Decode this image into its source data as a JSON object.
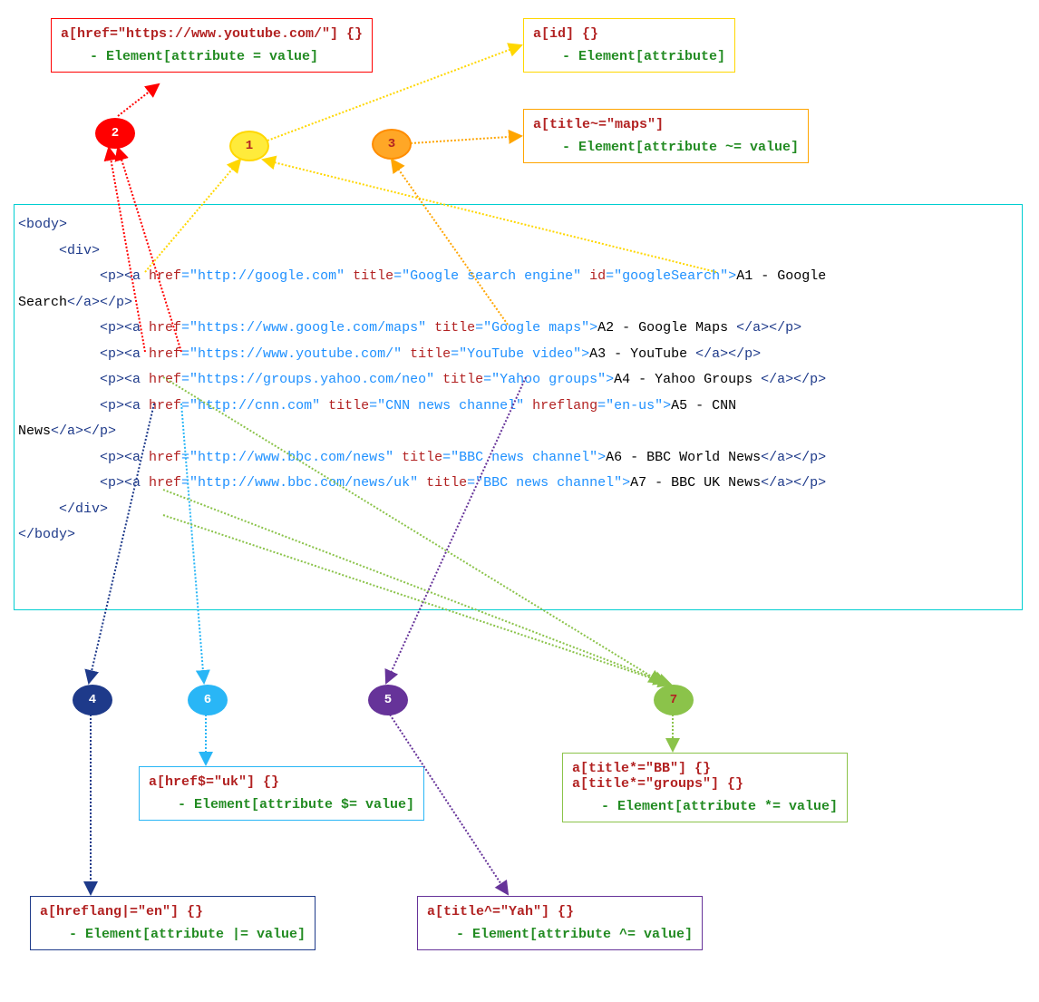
{
  "boxes": {
    "b1": {
      "rule": "a[id] {}",
      "pattern": "- Element[attribute]"
    },
    "b2": {
      "rule": "a[href=\"https://www.youtube.com/\"] {}",
      "pattern": "- Element[attribute = value]"
    },
    "b3": {
      "rule": "a[title~=\"maps\"]",
      "pattern": "- Element[attribute ~= value]"
    },
    "b4": {
      "rule": "a[hreflang|=\"en\"] {}",
      "pattern": "- Element[attribute |= value]"
    },
    "b5": {
      "rule": "a[title^=\"Yah\"] {}",
      "pattern": "- Element[attribute ^= value]"
    },
    "b6": {
      "rule": "a[href$=\"uk\"] {}",
      "pattern": "- Element[attribute $= value]"
    },
    "b7": {
      "rule1": "a[title*=\"BB\"] {}",
      "rule2": "a[title*=\"groups\"] {}",
      "pattern": "- Element[attribute *= value]"
    }
  },
  "ellipses": {
    "e1": "1",
    "e2": "2",
    "e3": "3",
    "e4": "4",
    "e5": "5",
    "e6": "6",
    "e7": "7"
  },
  "code": {
    "body_open": "<body>",
    "div_open": "<div>",
    "l1": {
      "pre": "          <p><a ",
      "href": "href",
      "hrefv": "=\"http://google.com\" ",
      "title": "title",
      "titlev": "=\"Google search engine\" ",
      "id": "id",
      "idv": "=\"googleSearch\">",
      "text": "A1 - Google",
      "wrap": "Search",
      "end": "</a></p>"
    },
    "l2": {
      "pre": "          <p><a ",
      "href": "href",
      "hrefv": "=\"https://www.google.com/maps\" ",
      "title": "title",
      "titlev": "=\"Google maps\">",
      "text": "A2 - Google Maps ",
      "end": "</a></p>"
    },
    "l3": {
      "pre": "          <p><a ",
      "href": "href",
      "hrefv": "=\"https://www.youtube.com/\" ",
      "title": "title",
      "titlev": "=\"YouTube video\">",
      "text": "A3 - YouTube ",
      "end": "</a></p>"
    },
    "l4": {
      "pre": "          <p><a ",
      "href": "href",
      "hrefv": "=\"https://groups.yahoo.com/neo\" ",
      "title": "title",
      "titlev": "=\"Yahoo groups\">",
      "text": "A4 - Yahoo Groups ",
      "end": "</a></p>"
    },
    "l5": {
      "pre": "          <p><a ",
      "href": "href",
      "hrefv": "=\"http://cnn.com\" ",
      "title": "title",
      "titlev": "=\"CNN news channel\" ",
      "lang": "hreflang",
      "langv": "=\"en-us\">",
      "text": "A5 - CNN",
      "wrap": "News",
      "end": "</a></p>"
    },
    "l6": {
      "pre": "          <p><a ",
      "href": "href",
      "hrefv": "=\"http://www.bbc.com/news\" ",
      "title": "title",
      "titlev": "=\"BBC news channel\">",
      "text": "A6 - BBC World News",
      "end": "</a></p>"
    },
    "l7": {
      "pre": "          <p><a ",
      "href": "href",
      "hrefv": "=\"http://www.bbc.com/news/uk\" ",
      "title": "title",
      "titlev": "=\"BBC news channel\">",
      "text": "A7 - BBC UK News",
      "end": "</a></p>"
    },
    "div_close": "</div>",
    "body_close": "</body>"
  }
}
